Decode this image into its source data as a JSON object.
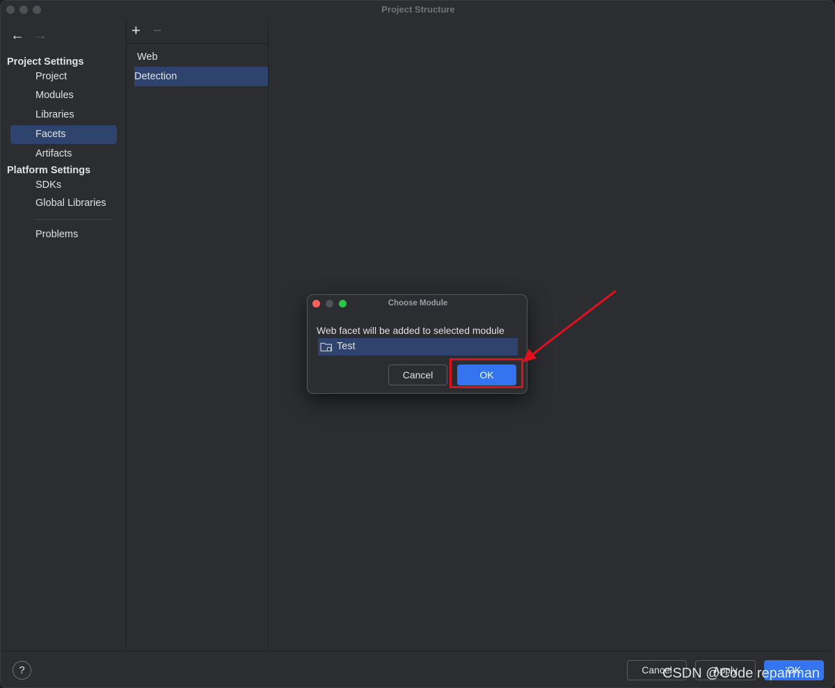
{
  "window": {
    "title": "Project Structure"
  },
  "nav": {
    "back_icon": "←",
    "forward_icon": "→"
  },
  "sidebar": {
    "project_settings": {
      "title": "Project Settings",
      "items": [
        {
          "label": "Project"
        },
        {
          "label": "Modules"
        },
        {
          "label": "Libraries"
        },
        {
          "label": "Facets",
          "selected": true
        },
        {
          "label": "Artifacts"
        }
      ]
    },
    "platform_settings": {
      "title": "Platform Settings",
      "items": [
        {
          "label": "SDKs"
        },
        {
          "label": "Global Libraries"
        }
      ]
    },
    "problems": {
      "label": "Problems"
    }
  },
  "facets": {
    "toolbar": {
      "add_icon": "+",
      "remove_icon": "−"
    },
    "items": [
      {
        "label": "Web"
      },
      {
        "label": "Detection",
        "selected": true
      }
    ]
  },
  "dialog": {
    "title": "Choose Module",
    "message": "Web facet will be added to selected module",
    "modules": [
      {
        "label": "Test",
        "icon": "folder-module-icon",
        "selected": true
      }
    ],
    "cancel_label": "Cancel",
    "ok_label": "OK"
  },
  "footer": {
    "help_label": "?",
    "cancel_label": "Cancel",
    "apply_label": "Apply",
    "ok_label": "OK"
  },
  "watermark": {
    "text": "CSDN @Code repairman"
  },
  "colors": {
    "accent": "#3574f0",
    "selection": "#2e436e",
    "annotation_red": "#e0101c",
    "close_light": "#ff5f57",
    "min_light": "#4e5157",
    "zoom_light": "#28c840"
  }
}
